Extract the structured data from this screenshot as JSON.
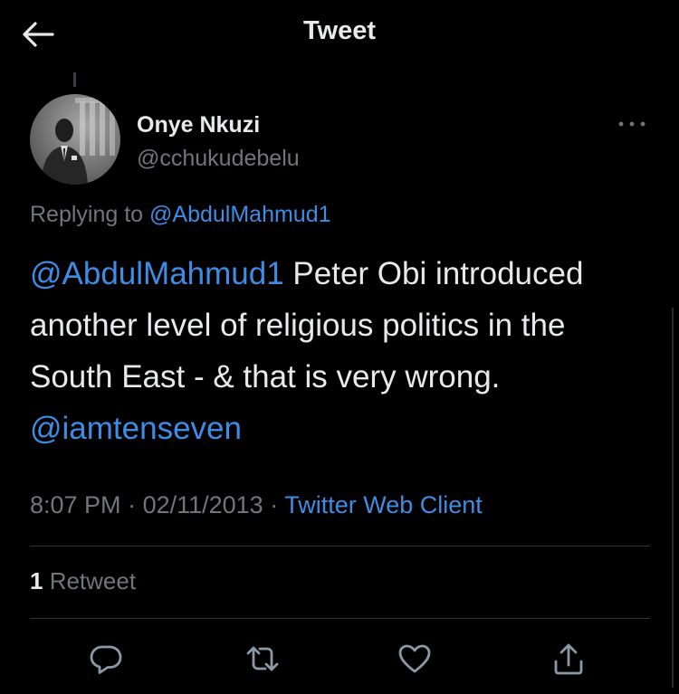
{
  "header": {
    "title": "Tweet",
    "back_icon": "arrow-left-icon"
  },
  "author": {
    "name": "Onye Nkuzi",
    "handle": "@cchukudebelu",
    "avatar_icon": "avatar"
  },
  "more_icon": "ellipsis-icon",
  "reply": {
    "prefix": "Replying to ",
    "target": "@AbdulMahmud1"
  },
  "tweet": {
    "mention_1": "@AbdulMahmud1",
    "text_main": " Peter Obi introduced another level of religious politics in the South East - & that is very wrong. ",
    "mention_2": "@iamtenseven"
  },
  "meta": {
    "time": "8:07 PM",
    "separator": " · ",
    "date": "02/11/2013",
    "source": "Twitter Web Client"
  },
  "stats": {
    "retweet_count": "1",
    "retweet_label": " Retweet"
  },
  "actions": [
    {
      "name": "reply-icon"
    },
    {
      "name": "retweet-icon"
    },
    {
      "name": "like-icon"
    },
    {
      "name": "share-icon"
    }
  ],
  "colors": {
    "background": "#000000",
    "text": "#e7e9ea",
    "secondary": "#71767b",
    "link": "#3d8ce5",
    "divider": "#2f3336"
  }
}
